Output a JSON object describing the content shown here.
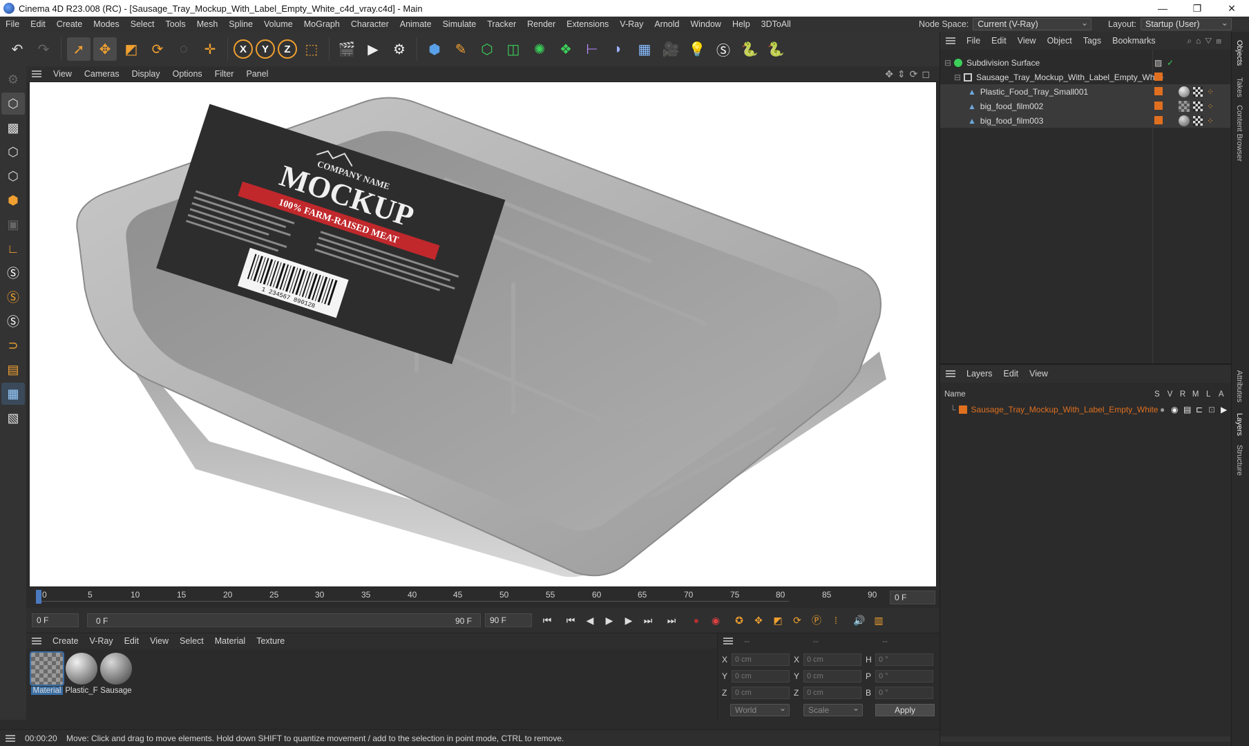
{
  "window": {
    "title": "Cinema 4D R23.008 (RC) - [Sausage_Tray_Mockup_With_Label_Empty_White_c4d_vray.c4d] - Main",
    "minimize": "—",
    "maximize": "❐",
    "close": "✕"
  },
  "menubar": {
    "items": [
      "File",
      "Edit",
      "Create",
      "Modes",
      "Select",
      "Tools",
      "Mesh",
      "Spline",
      "Volume",
      "MoGraph",
      "Character",
      "Animate",
      "Simulate",
      "Tracker",
      "Render",
      "Extensions",
      "V-Ray",
      "Arnold",
      "Window",
      "Help",
      "3DToAll"
    ],
    "node_space_label": "Node Space:",
    "node_space_value": "Current (V-Ray)",
    "layout_label": "Layout:",
    "layout_value": "Startup (User)"
  },
  "viewport": {
    "menu": [
      "View",
      "Cameras",
      "Display",
      "Options",
      "Filter",
      "Panel"
    ],
    "label": {
      "company": "COMPANY NAME",
      "brand": "MOCKUP",
      "tagline": "100% FARM-RAISED MEAT",
      "barcode_digits": "1 234567 890128"
    }
  },
  "timeline": {
    "ticks": [
      "0",
      "5",
      "10",
      "15",
      "20",
      "25",
      "30",
      "35",
      "40",
      "45",
      "50",
      "55",
      "60",
      "65",
      "70",
      "75",
      "80",
      "85",
      "90"
    ],
    "current_frame": "0 F",
    "start_field": "0 F",
    "range_start": "0 F",
    "range_end": "90 F",
    "end_field": "90 F"
  },
  "materials": {
    "menu": [
      "Create",
      "V-Ray",
      "Edit",
      "View",
      "Select",
      "Material",
      "Texture"
    ],
    "items": [
      "Material",
      "Plastic_F",
      "Sausage"
    ]
  },
  "coordinates": {
    "headers": [
      "--",
      "--",
      "--"
    ],
    "rows": [
      {
        "a": "X",
        "av": "0 cm",
        "b": "X",
        "bv": "0 cm",
        "c": "H",
        "cv": "0 °"
      },
      {
        "a": "Y",
        "av": "0 cm",
        "b": "Y",
        "bv": "0 cm",
        "c": "P",
        "cv": "0 °"
      },
      {
        "a": "Z",
        "av": "0 cm",
        "b": "Z",
        "bv": "0 cm",
        "c": "B",
        "cv": "0 °"
      }
    ],
    "world": "World",
    "scale": "Scale",
    "apply": "Apply"
  },
  "status": {
    "time": "00:00:20",
    "message": "Move: Click and drag to move elements. Hold down SHIFT to quantize movement / add to the selection in point mode, CTRL to remove."
  },
  "objects": {
    "menu": [
      "File",
      "Edit",
      "View",
      "Object",
      "Tags",
      "Bookmarks"
    ],
    "items": [
      {
        "name": "Subdivision Surface",
        "level": 0
      },
      {
        "name": "Sausage_Tray_Mockup_With_Label_Empty_White",
        "level": 1
      },
      {
        "name": "Plastic_Food_Tray_Small001",
        "level": 2
      },
      {
        "name": "big_food_film002",
        "level": 2
      },
      {
        "name": "big_food_film003",
        "level": 2
      }
    ]
  },
  "layers": {
    "menu": [
      "Layers",
      "Edit",
      "View"
    ],
    "col_name": "Name",
    "cols": [
      "S",
      "V",
      "R",
      "M",
      "L",
      "A"
    ],
    "items": [
      "Sausage_Tray_Mockup_With_Label_Empty_White"
    ]
  },
  "side_tabs": [
    "Objects",
    "Takes",
    "Content Browser",
    "Attributes",
    "Layers",
    "Structure"
  ],
  "colors": {
    "accent_orange": "#e07020",
    "selection_blue": "#3a6ea5",
    "panel_bg": "#2b2b2b"
  }
}
